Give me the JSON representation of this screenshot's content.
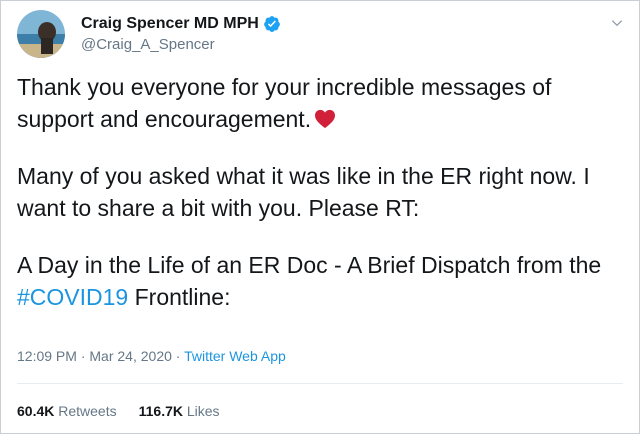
{
  "author": {
    "display_name": "Craig Spencer MD MPH",
    "handle": "@Craig_A_Spencer",
    "verified": true
  },
  "tweet": {
    "paragraph_1": "Thank you everyone for your incredible messages of support and encouragement.",
    "paragraph_2": "Many of you asked what it was like in the ER right now. I want to share a bit with you. Please RT:",
    "paragraph_3_before": "A Day in the Life of an ER Doc - A Brief Dispatch from the ",
    "hashtag": "#COVID19",
    "paragraph_3_after": " Frontline:"
  },
  "meta": {
    "time": "12:09 PM",
    "separator": " · ",
    "date": "Mar 24, 2020",
    "source": "Twitter Web App"
  },
  "stats": {
    "retweets_count": "60.4K",
    "retweets_label": "Retweets",
    "likes_count": "116.7K",
    "likes_label": "Likes"
  },
  "icons": {
    "verified": "verified-badge-icon",
    "heart": "red-heart-emoji",
    "caret": "chevron-down-icon"
  },
  "colors": {
    "link": "#1b95e0",
    "secondary_text": "#657786",
    "heart": "#d0203a"
  }
}
